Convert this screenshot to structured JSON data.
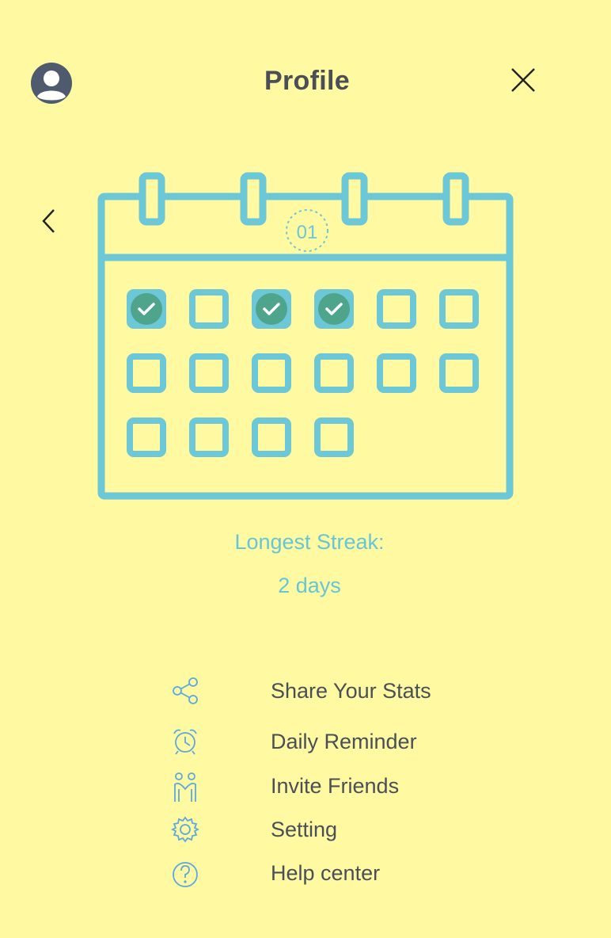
{
  "header": {
    "title": "Profile",
    "avatar_icon": "user-avatar-icon",
    "close_icon": "close-icon"
  },
  "calendar": {
    "icon": "calendar-icon",
    "back_icon": "chevron-left-icon",
    "date_badge": "01",
    "accent_color": "#6cc7d6",
    "check_color": "#4fa58b",
    "days_checked": [
      true,
      false,
      true,
      true,
      false,
      false,
      false,
      false,
      false,
      false,
      false,
      false,
      false,
      false,
      false,
      false
    ]
  },
  "streak": {
    "label": "Longest Streak:",
    "value": "2 days"
  },
  "menu": {
    "items": [
      {
        "label": "Share Your Stats",
        "icon": "share-icon"
      },
      {
        "label": "Daily Reminder",
        "icon": "alarm-clock-icon"
      },
      {
        "label": "Invite Friends",
        "icon": "friends-icon"
      },
      {
        "label": "Setting",
        "icon": "gear-icon"
      },
      {
        "label": "Help center",
        "icon": "help-icon"
      }
    ]
  },
  "colors": {
    "background": "#fff9a1",
    "text_dark": "#4a4f57",
    "accent": "#66c6d8",
    "icon_blue": "#5aa9e0"
  }
}
